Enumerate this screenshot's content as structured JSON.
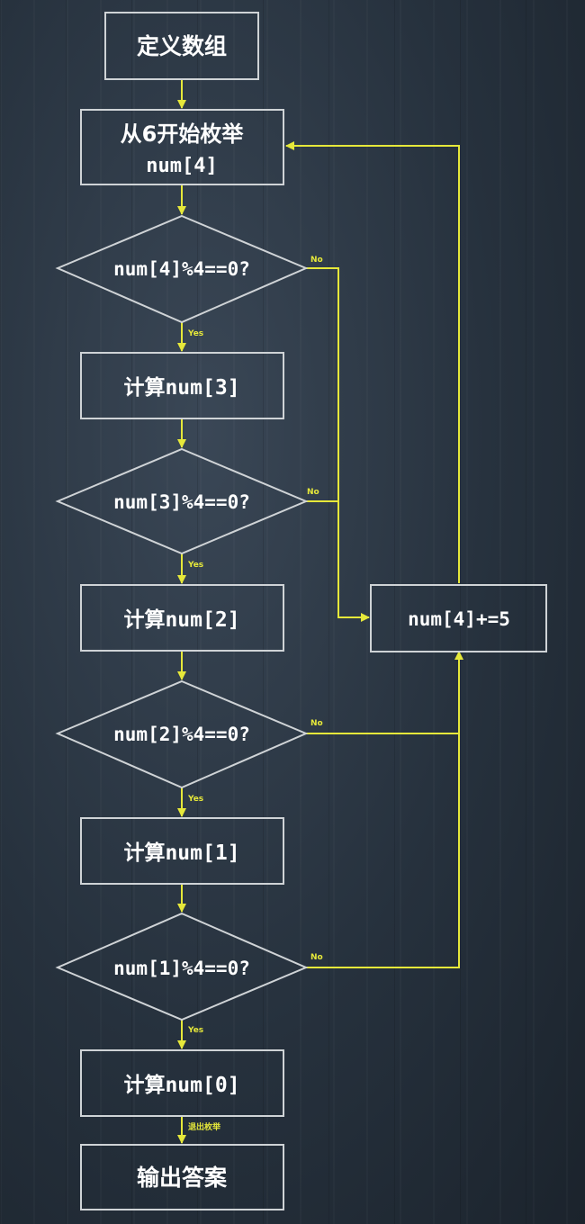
{
  "nodes": {
    "define_array": "定义数组",
    "enum_from_6": "从6开始枚举",
    "enum_var": "num[4]",
    "check_4": "num[4]%4==0?",
    "calc_3": "计算num[3]",
    "check_3": "num[3]%4==0?",
    "calc_2": "计算num[2]",
    "check_2": "num[2]%4==0?",
    "calc_1": "计算num[1]",
    "check_1": "num[1]%4==0?",
    "calc_0": "计算num[0]",
    "output": "输出答案",
    "increment": "num[4]+=5"
  },
  "edge_labels": {
    "yes": "Yes",
    "no": "No",
    "exit_enum": "退出枚举"
  },
  "colors": {
    "node_border": "#cfd3d6",
    "flow_line": "#e6e83a",
    "text": "#ffffff"
  }
}
